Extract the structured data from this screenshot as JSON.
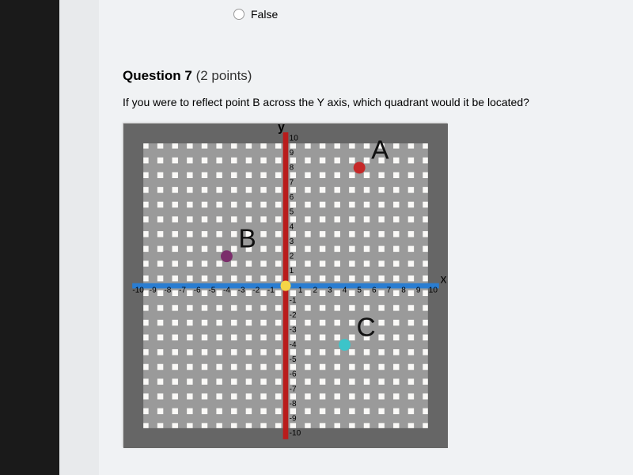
{
  "prev_answer": {
    "false_label": "False"
  },
  "question": {
    "heading_prefix": "Question ",
    "number": "7",
    "points_text": " (2 points)",
    "prompt": "If you were to reflect point B across the Y axis, which quadrant would it be located?"
  },
  "chart_data": {
    "type": "scatter",
    "title": "",
    "xlabel": "x",
    "ylabel": "y",
    "xlim": [
      -10,
      10
    ],
    "ylim": [
      -10,
      10
    ],
    "gridlines": true,
    "axes_style": {
      "x_color": "#2a7dd1",
      "y_color": "#b91c1c",
      "origin_color": "#f5d547"
    },
    "series": [
      {
        "name": "A",
        "x": 5,
        "y": 8
      },
      {
        "name": "B",
        "x": -4,
        "y": 2
      },
      {
        "name": "C",
        "x": 4,
        "y": -4
      }
    ],
    "ticks_x": [
      -10,
      -9,
      -8,
      -7,
      -6,
      -5,
      -4,
      -3,
      -2,
      -1,
      1,
      2,
      3,
      4,
      5,
      6,
      7,
      8,
      9,
      10
    ],
    "ticks_y": [
      -10,
      -9,
      -8,
      -7,
      -6,
      -5,
      -4,
      -3,
      -2,
      -1,
      1,
      2,
      3,
      4,
      5,
      6,
      7,
      8,
      9,
      10
    ]
  }
}
